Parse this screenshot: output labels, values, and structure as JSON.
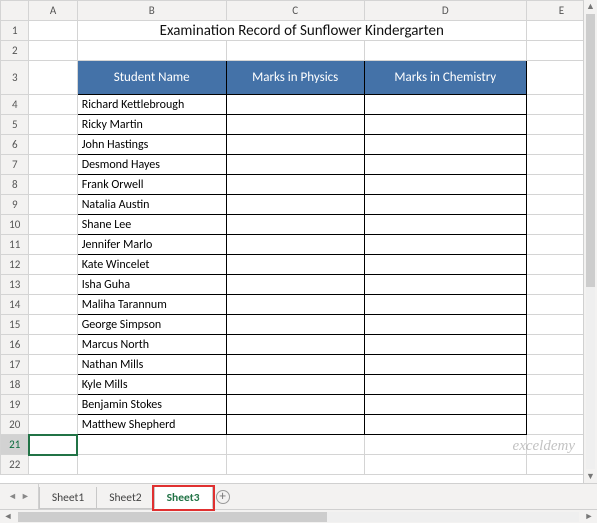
{
  "columns": [
    "A",
    "B",
    "C",
    "D",
    "E"
  ],
  "title": "Examination Record of Sunflower Kindergarten",
  "headers": {
    "name": "Student Name",
    "physics": "Marks in Physics",
    "chemistry": "Marks in Chemistry"
  },
  "students": [
    {
      "name": "Richard Kettlebrough",
      "physics": "",
      "chemistry": ""
    },
    {
      "name": "Ricky Martin",
      "physics": "",
      "chemistry": ""
    },
    {
      "name": "John Hastings",
      "physics": "",
      "chemistry": ""
    },
    {
      "name": "Desmond Hayes",
      "physics": "",
      "chemistry": ""
    },
    {
      "name": "Frank Orwell",
      "physics": "",
      "chemistry": ""
    },
    {
      "name": "Natalia Austin",
      "physics": "",
      "chemistry": ""
    },
    {
      "name": "Shane Lee",
      "physics": "",
      "chemistry": ""
    },
    {
      "name": "Jennifer Marlo",
      "physics": "",
      "chemistry": ""
    },
    {
      "name": "Kate Wincelet",
      "physics": "",
      "chemistry": ""
    },
    {
      "name": "Isha Guha",
      "physics": "",
      "chemistry": ""
    },
    {
      "name": "Maliha Tarannum",
      "physics": "",
      "chemistry": ""
    },
    {
      "name": "George Simpson",
      "physics": "",
      "chemistry": ""
    },
    {
      "name": "Marcus North",
      "physics": "",
      "chemistry": ""
    },
    {
      "name": "Nathan Mills",
      "physics": "",
      "chemistry": ""
    },
    {
      "name": "Kyle Mills",
      "physics": "",
      "chemistry": ""
    },
    {
      "name": "Benjamin Stokes",
      "physics": "",
      "chemistry": ""
    },
    {
      "name": "Matthew Shepherd",
      "physics": "",
      "chemistry": ""
    }
  ],
  "row_start": 1,
  "row_end": 22,
  "selected_row": 21,
  "tabs": [
    "Sheet1",
    "Sheet2",
    "Sheet3"
  ],
  "active_tab": "Sheet3",
  "add_tab_glyph": "+",
  "nav": {
    "first": "◄",
    "prev": "◄",
    "next": "►",
    "last": "►"
  },
  "watermark": "exceldemy"
}
